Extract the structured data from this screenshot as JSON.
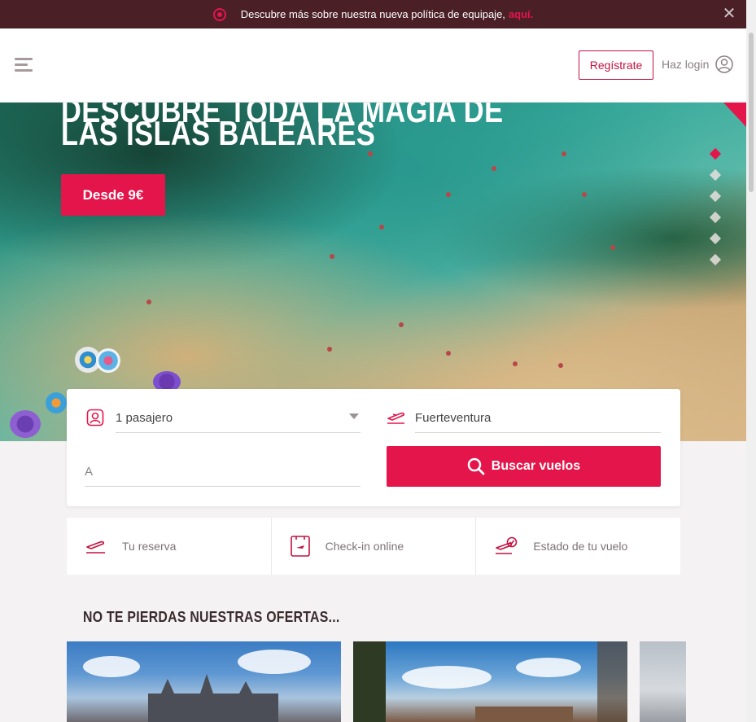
{
  "announcement": {
    "text": "Descubre más sobre nuestra nueva política de equipaje,",
    "link": "aquí.",
    "close_icon": "close-icon"
  },
  "header": {
    "menu_icon": "hamburger-icon",
    "register_label": "Regístrate",
    "login_label": "Haz login",
    "user_icon": "user-icon"
  },
  "hero": {
    "title_line1": "DESCUBRE TODA LA MAGIA DE",
    "title_line2": "LAS ISLAS BALEARES",
    "cta_label": "Desde 9€",
    "slides_count": 6,
    "active_slide": 1
  },
  "search": {
    "passengers_value": "1 pasajero",
    "origin_value": "Fuerteventura",
    "destination_placeholder": "A",
    "search_button": "Buscar vuelos"
  },
  "quick_links": [
    {
      "label": "Tu reserva",
      "icon": "plane-landing-icon"
    },
    {
      "label": "Check-in online",
      "icon": "boarding-pass-icon"
    },
    {
      "label": "Estado de tu vuelo",
      "icon": "flight-status-icon"
    }
  ],
  "offers": {
    "title": "NO TE PIERDAS NUESTRAS OFERTAS..."
  },
  "colors": {
    "brand": "#e4154b",
    "topbar": "#4a1f26"
  }
}
